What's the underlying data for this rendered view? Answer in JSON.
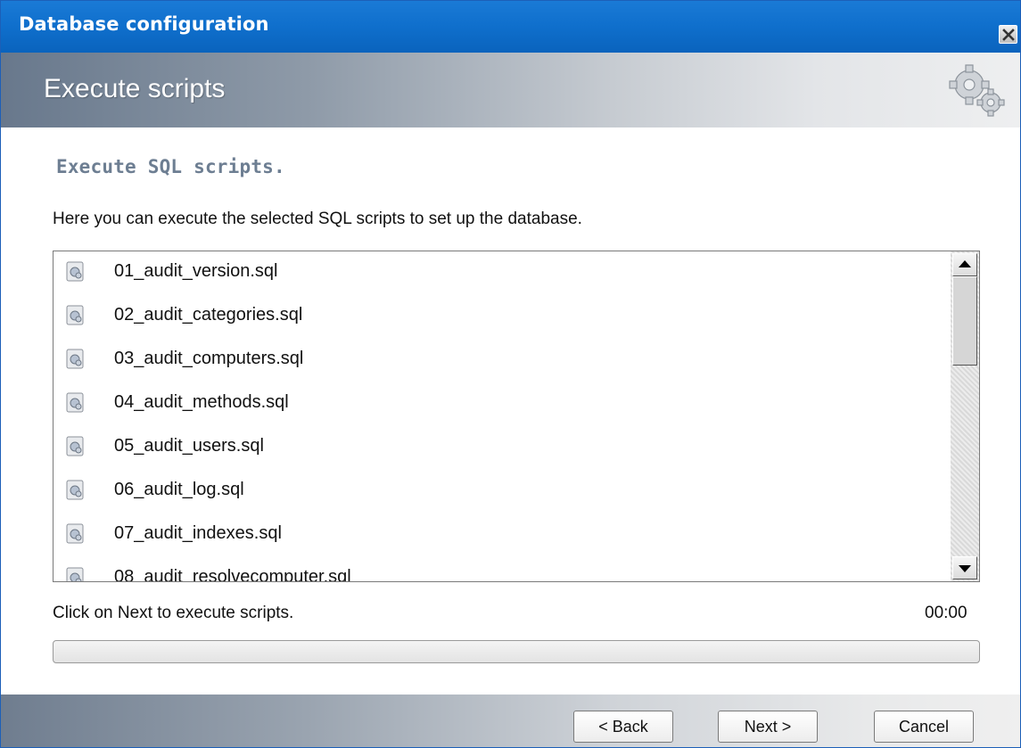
{
  "window": {
    "title": "Database configuration",
    "header_title": "Execute scripts"
  },
  "content": {
    "section_title": "Execute SQL scripts.",
    "description": "Here you can execute the selected SQL scripts to set up the database.",
    "scripts": [
      "01_audit_version.sql",
      "02_audit_categories.sql",
      "03_audit_computers.sql",
      "04_audit_methods.sql",
      "05_audit_users.sql",
      "06_audit_log.sql",
      "07_audit_indexes.sql",
      "08_audit_resolvecomputer.sql"
    ],
    "status_text": "Click on Next to execute scripts.",
    "elapsed_time": "00:00",
    "progress_fraction": 0
  },
  "buttons": {
    "back": "< Back",
    "next": "Next >",
    "cancel": "Cancel"
  },
  "icons": {
    "close": "close-icon",
    "header": "gears-icon",
    "script": "sql-script-file-icon"
  },
  "colors": {
    "titlebar": "#0f6fcc",
    "section_title": "#6d7e92"
  }
}
